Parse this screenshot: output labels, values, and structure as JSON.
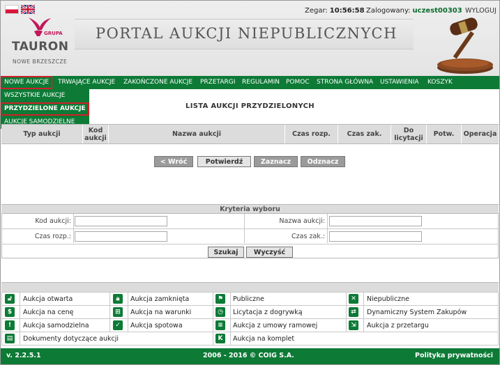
{
  "header": {
    "clock_label": "Zegar:",
    "clock_value": "10:56:58",
    "logged_label": "Zalogowany:",
    "user": "uczest00303",
    "logout": "WYLOGUJ",
    "banner_title": "PORTAL AUKCJI NIEPUBLICZNYCH",
    "logo": {
      "grupa": "GRUPA",
      "name": "TAURON",
      "tagline": "NOWE BRZESZCZE"
    }
  },
  "nav": {
    "items": [
      "NOWE AUKCJE",
      "TRWAJĄCE AUKCJE",
      "ZAKOŃCZONE AUKCJE",
      "PRZETARGI",
      "REGULAMIN",
      "POMOC",
      "STRONA GŁÓWNA",
      "USTAWIENIA",
      "KOSZYK"
    ],
    "active_index": 0,
    "submenu": [
      "WSZYSTKIE AUKCJE",
      "PRZYDZIELONE AUKCJE",
      "AUKCJE SAMODZIELNE"
    ],
    "submenu_selected": 1
  },
  "page_title": "LISTA AUKCJI PRZYDZIELONYCH",
  "table": {
    "columns": [
      "Typ aukcji",
      "Kod aukcji",
      "Nazwa aukcji",
      "Czas rozp.",
      "Czas zak.",
      "Do licytacji",
      "Potw.",
      "Operacja"
    ],
    "rows": []
  },
  "buttons": {
    "back": "< Wróć",
    "confirm": "Potwierdź",
    "select": "Zaznacz",
    "deselect": "Odznacz"
  },
  "criteria": {
    "title": "Kryteria wyboru",
    "code_label": "Kod aukcji:",
    "name_label": "Nazwa aukcji:",
    "start_label": "Czas rozp.:",
    "end_label": "Czas zak.:",
    "search": "Szukaj",
    "clear": "Wyczyść"
  },
  "legend": {
    "items": [
      {
        "icon": "unlock-icon",
        "label": "Aukcja otwarta"
      },
      {
        "icon": "lock-icon",
        "label": "Aukcja zamknięta"
      },
      {
        "icon": "flag-icon",
        "label": "Publiczne"
      },
      {
        "icon": "x-icon",
        "label": "Niepubliczne"
      },
      {
        "icon": "dollar-icon",
        "label": "Aukcja na cenę"
      },
      {
        "icon": "cart-icon",
        "label": "Aukcja na warunki"
      },
      {
        "icon": "clock-icon",
        "label": "Licytacja z dogrywką"
      },
      {
        "icon": "dps-icon",
        "label": "Dynamiczny System Zakupów"
      },
      {
        "icon": "exclamation-icon",
        "label": "Aukcja samodzielna"
      },
      {
        "icon": "check-circle-icon",
        "label": "Aukcja spotowa"
      },
      {
        "icon": "document-icon",
        "label": "Aukcja z umowy ramowej"
      },
      {
        "icon": "tender-icon",
        "label": "Aukcja z przetargu"
      },
      {
        "icon": "file-icon",
        "label": "Dokumenty dotyczące aukcji"
      },
      {
        "icon": "k-icon",
        "label": "Aukcja na komplet"
      }
    ]
  },
  "footer": {
    "version": "v. 2.2.5.1",
    "copyright": "2006 - 2016 © COIG S.A.",
    "privacy": "Polityka prywatności"
  },
  "colors": {
    "green": "#0d7a36",
    "highlight": "#d0202a",
    "user": "#0c6b2c"
  }
}
